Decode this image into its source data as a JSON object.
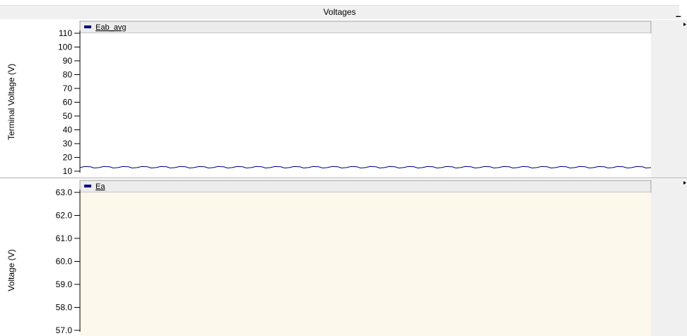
{
  "window": {
    "title": "Voltages",
    "minimize_label": "–"
  },
  "colors": {
    "series": "#000080",
    "panel2_bg": "#fdf8ec",
    "panel_bg": "#ffffff",
    "side_bg": "#f0f0f0"
  },
  "chart_data": [
    {
      "type": "line",
      "ylabel": "Terminal Voltage (V)",
      "ylim": [
        10,
        110
      ],
      "yticks": [
        10,
        20,
        30,
        40,
        50,
        60,
        70,
        80,
        90,
        100,
        110
      ],
      "grid": false,
      "series": [
        {
          "name": "Eab_avg",
          "approx_mean": 12.8,
          "ripple_min": 12.3,
          "ripple_max": 13.4,
          "cycles": 30
        }
      ]
    },
    {
      "type": "line",
      "ylabel": "Voltage (V)",
      "ylim": [
        57.0,
        63.0
      ],
      "yticks": [
        "57.0",
        "58.0",
        "59.0",
        "60.0",
        "61.0",
        "62.0",
        "63.0"
      ],
      "grid": false,
      "series": [
        {
          "name": "Ea"
        }
      ]
    }
  ]
}
